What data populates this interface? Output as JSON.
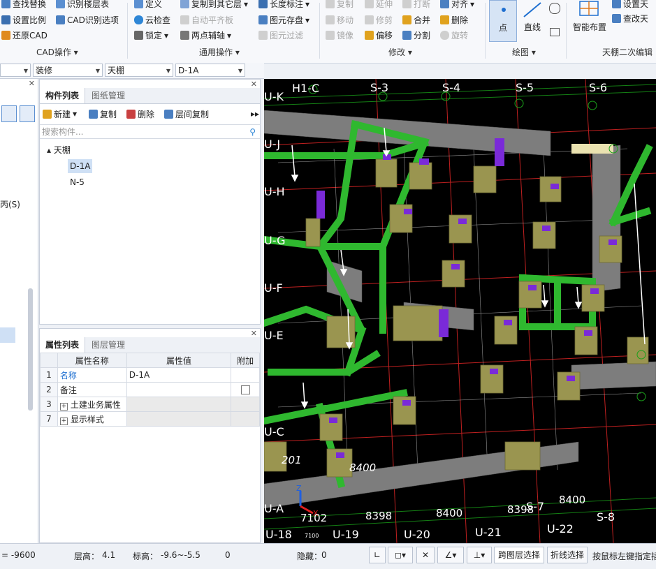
{
  "ribbon": {
    "cad_group": {
      "label": "CAD操作",
      "items": [
        "查找替换",
        "识别楼层表",
        "设置比例",
        "CAD识别选项",
        "还原CAD"
      ]
    },
    "common_group": {
      "label": "通用操作",
      "items": [
        "定义",
        "复制到其它层",
        "长度标注",
        "云检查",
        "自动平齐板",
        "图元存盘",
        "锁定",
        "两点辅轴",
        "图元过滤"
      ]
    },
    "modify_group": {
      "label": "修改",
      "items": [
        "复制",
        "延伸",
        "打断",
        "对齐",
        "移动",
        "修剪",
        "合并",
        "删除",
        "镜像",
        "偏移",
        "分割",
        "旋转"
      ]
    },
    "draw_group": {
      "label": "绘图",
      "items": [
        "点",
        "直线"
      ]
    },
    "ceiling_group": {
      "label": "天棚二次编辑",
      "items": [
        "智能布置",
        "设置天",
        "查改天"
      ]
    }
  },
  "selectors": {
    "s1": "",
    "s2": "装修",
    "s3": "天棚",
    "s4": "D-1A"
  },
  "left_panel": {
    "fragment": "丙(S)"
  },
  "component_panel": {
    "tabs": [
      "构件列表",
      "图纸管理"
    ],
    "toolbar": {
      "new": "新建",
      "copy": "复制",
      "delete": "删除",
      "floor_copy": "层间复制"
    },
    "search_placeholder": "搜索构件...",
    "tree": {
      "root": "天棚",
      "children": [
        "D-1A",
        "N-5"
      ],
      "selected": "D-1A"
    }
  },
  "property_panel": {
    "tabs": [
      "属性列表",
      "图层管理"
    ],
    "headers": [
      "属性名称",
      "属性值",
      "附加"
    ],
    "rows": [
      {
        "num": "1",
        "name": "名称",
        "value": "D-1A"
      },
      {
        "num": "2",
        "name": "备注",
        "value": ""
      },
      {
        "num": "3",
        "name": "土建业务属性",
        "value": ""
      },
      {
        "num": "7",
        "name": "显示样式",
        "value": ""
      }
    ]
  },
  "viewport": {
    "axis_labels_top": [
      "H1-C",
      "S-3",
      "S-4",
      "S-5",
      "S-6"
    ],
    "axis_labels_left": [
      "U-K",
      "U-J",
      "U-H",
      "U-G",
      "U-F",
      "U-E",
      "U-C",
      "U-A"
    ],
    "axis_labels_bottom": [
      "U-18",
      "U-19",
      "U-20",
      "U-21",
      "U-22",
      "S-7",
      "S-8"
    ],
    "dimensions": [
      "8400",
      "7102",
      "8398",
      "8400",
      "8398",
      "8400",
      "201",
      "7100"
    ],
    "background": "#000000",
    "beam_color": "#2fb82f",
    "column_color": "#9a9550",
    "wall_color": "#8a8a8a"
  },
  "status": {
    "elevation_left": "= -9600",
    "floor_height_label": "层高：",
    "floor_height": "4.1",
    "elev_label": "标高：",
    "elev_range": "-9.6~-5.5",
    "zero": "0",
    "hidden_label": "隐藏：",
    "hidden_value": "0",
    "cross_layer": "跨图层选择",
    "polyline": "折线选择",
    "hint": "按鼠标左键指定插"
  }
}
